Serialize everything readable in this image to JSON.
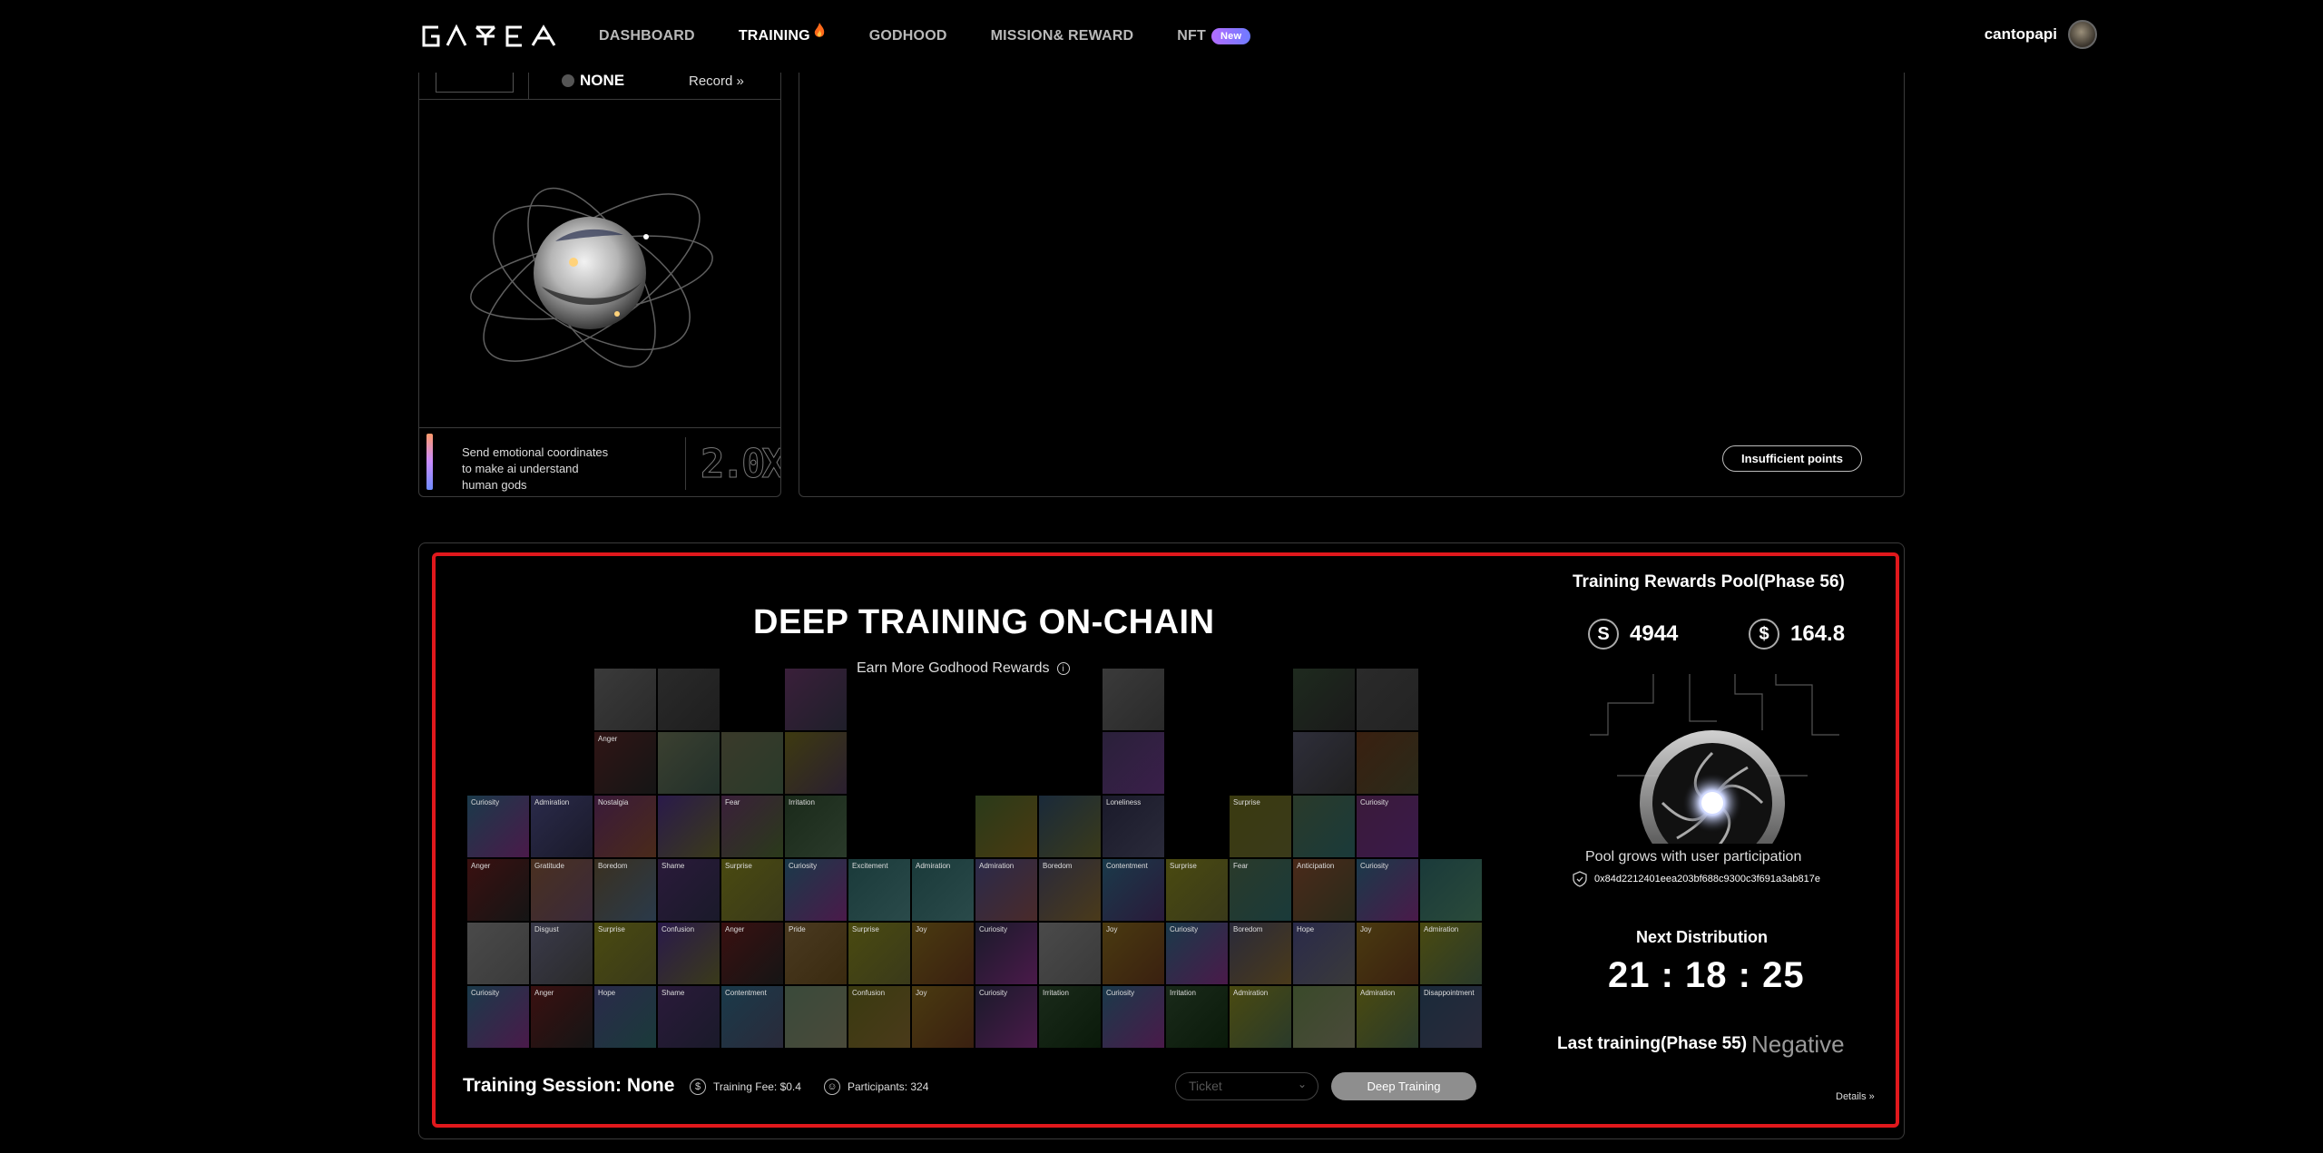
{
  "header": {
    "logo_text": "GAYEA",
    "nav": [
      {
        "label": "DASHBOARD"
      },
      {
        "label": "TRAINING"
      },
      {
        "label": "GODHOOD"
      },
      {
        "label": "MISSION& REWARD"
      },
      {
        "label": "NFT"
      }
    ],
    "nft_badge": "New",
    "username": "cantopapi"
  },
  "left_panel": {
    "status": "NONE",
    "record_label": "Record »",
    "emotion_text": "Send emotional coordinates to make ai understand human gods",
    "multiplier": "2.0X"
  },
  "right_panel": {
    "insufficient_label": "Insufficient points"
  },
  "deep_training": {
    "title": "DEEP TRAINING ON-CHAIN",
    "subtitle": "Earn More Godhood Rewards",
    "session_label": "Training Session: None",
    "fee_label": "Training Fee: $0.4",
    "participants_label": "Participants: 324",
    "ticket_placeholder": "Ticket",
    "deep_button": "Deep Training",
    "emotion_cells": [
      {
        "col": 2,
        "row": 0,
        "label": "",
        "c1": "#3a3a3a",
        "c2": "#2a2a2a"
      },
      {
        "col": 3,
        "row": 0,
        "label": "",
        "c1": "#2a2a2a",
        "c2": "#1e1e1e"
      },
      {
        "col": 5,
        "row": 0,
        "label": "",
        "c1": "#3a1f3a",
        "c2": "#1f1f2a"
      },
      {
        "col": 10,
        "row": 0,
        "label": "",
        "c1": "#3a3a3a",
        "c2": "#2a2a2a"
      },
      {
        "col": 13,
        "row": 0,
        "label": "",
        "c1": "#1e2a1e",
        "c2": "#1a1a1a"
      },
      {
        "col": 14,
        "row": 0,
        "label": "",
        "c1": "#2a2a2a",
        "c2": "#232323"
      },
      {
        "col": 2,
        "row": 1,
        "label": "Anger",
        "c1": "#301515",
        "c2": "#151515"
      },
      {
        "col": 3,
        "row": 1,
        "label": "",
        "c1": "#3b4030",
        "c2": "#22302a"
      },
      {
        "col": 4,
        "row": 1,
        "label": "",
        "c1": "#3a3a2a",
        "c2": "#2a3a2a"
      },
      {
        "col": 5,
        "row": 1,
        "label": "",
        "c1": "#3e3a10",
        "c2": "#2a1f30"
      },
      {
        "col": 10,
        "row": 1,
        "label": "",
        "c1": "#2a203a",
        "c2": "#3a1f4a"
      },
      {
        "col": 13,
        "row": 1,
        "label": "",
        "c1": "#2e2e3a",
        "c2": "#202020"
      },
      {
        "col": 14,
        "row": 1,
        "label": "",
        "c1": "#3a2010",
        "c2": "#2a2a1a"
      },
      {
        "col": 0,
        "row": 2,
        "label": "Curiosity",
        "c1": "#1a3a4a",
        "c2": "#4a1a4a"
      },
      {
        "col": 1,
        "row": 2,
        "label": "Admiration",
        "c1": "#2a2a4a",
        "c2": "#1a1a2a"
      },
      {
        "col": 2,
        "row": 2,
        "label": "Nostalgia",
        "c1": "#3a1a3a",
        "c2": "#4a2a1a"
      },
      {
        "col": 3,
        "row": 2,
        "label": "",
        "c1": "#2a1a4a",
        "c2": "#3a3a1a"
      },
      {
        "col": 4,
        "row": 2,
        "label": "Fear",
        "c1": "#3a1f3a",
        "c2": "#2a3a1a"
      },
      {
        "col": 5,
        "row": 2,
        "label": "Irritation",
        "c1": "#1a2a1a",
        "c2": "#2a3a2a"
      },
      {
        "col": 8,
        "row": 2,
        "label": "",
        "c1": "#2a3a1a",
        "c2": "#4a3a10"
      },
      {
        "col": 9,
        "row": 2,
        "label": "",
        "c1": "#1a2a3a",
        "c2": "#3a3a1a"
      },
      {
        "col": 10,
        "row": 2,
        "label": "Loneliness",
        "c1": "#1a1a2a",
        "c2": "#2a2a3a"
      },
      {
        "col": 12,
        "row": 2,
        "label": "Surprise",
        "c1": "#3a3a10",
        "c2": "#3a3a1a"
      },
      {
        "col": 13,
        "row": 2,
        "label": "",
        "c1": "#2a3a2a",
        "c2": "#1a3a3a"
      },
      {
        "col": 14,
        "row": 2,
        "label": "Curiosity",
        "c1": "#3a1a3a",
        "c2": "#3a1a4a"
      },
      {
        "col": 0,
        "row": 3,
        "label": "Anger",
        "c1": "#3a1010",
        "c2": "#151515"
      },
      {
        "col": 1,
        "row": 3,
        "label": "Gratitude",
        "c1": "#4a3020",
        "c2": "#3a2a3a"
      },
      {
        "col": 2,
        "row": 3,
        "label": "Boredom",
        "c1": "#3a3020",
        "c2": "#2a3a4a"
      },
      {
        "col": 3,
        "row": 3,
        "label": "Shame",
        "c1": "#2a1a3a",
        "c2": "#1a1a2a"
      },
      {
        "col": 4,
        "row": 3,
        "label": "Surprise",
        "c1": "#4a4a10",
        "c2": "#3a3a1a"
      },
      {
        "col": 5,
        "row": 3,
        "label": "Curiosity",
        "c1": "#1a3a4a",
        "c2": "#4a1a4a"
      },
      {
        "col": 6,
        "row": 3,
        "label": "Excitement",
        "c1": "#1a3a3a",
        "c2": "#2a4a4a"
      },
      {
        "col": 7,
        "row": 3,
        "label": "Admiration",
        "c1": "#1a3a3a",
        "c2": "#2a4a4a"
      },
      {
        "col": 8,
        "row": 3,
        "label": "Admiration",
        "c1": "#2a2a4a",
        "c2": "#4a2a2a"
      },
      {
        "col": 9,
        "row": 3,
        "label": "Boredom",
        "c1": "#2a2a3a",
        "c2": "#4a3a1a"
      },
      {
        "col": 10,
        "row": 3,
        "label": "Contentment",
        "c1": "#1a3a4a",
        "c2": "#2a1a3a"
      },
      {
        "col": 11,
        "row": 3,
        "label": "Surprise",
        "c1": "#4a4a10",
        "c2": "#3a3a1a"
      },
      {
        "col": 12,
        "row": 3,
        "label": "Fear",
        "c1": "#2a3a2a",
        "c2": "#1a3a3a"
      },
      {
        "col": 13,
        "row": 3,
        "label": "Anticipation",
        "c1": "#4a2a1a",
        "c2": "#2a2a1a"
      },
      {
        "col": 14,
        "row": 3,
        "label": "Curiosity",
        "c1": "#1a3a4a",
        "c2": "#4a1a4a"
      },
      {
        "col": 15,
        "row": 3,
        "label": "",
        "c1": "#1a3a3a",
        "c2": "#2a4a3a"
      },
      {
        "col": 0,
        "row": 4,
        "label": "",
        "c1": "#4a4a4a",
        "c2": "#3a3a3a"
      },
      {
        "col": 1,
        "row": 4,
        "label": "Disgust",
        "c1": "#3a3a4a",
        "c2": "#2a2a2a"
      },
      {
        "col": 2,
        "row": 4,
        "label": "Surprise",
        "c1": "#4a4a10",
        "c2": "#3a3a1a"
      },
      {
        "col": 3,
        "row": 4,
        "label": "Confusion",
        "c1": "#2a1a4a",
        "c2": "#3a3a1a"
      },
      {
        "col": 4,
        "row": 4,
        "label": "Anger",
        "c1": "#3a1010",
        "c2": "#151515"
      },
      {
        "col": 5,
        "row": 4,
        "label": "Pride",
        "c1": "#4a3a20",
        "c2": "#3a2a10"
      },
      {
        "col": 6,
        "row": 4,
        "label": "Surprise",
        "c1": "#4a4a10",
        "c2": "#3a3a1a"
      },
      {
        "col": 7,
        "row": 4,
        "label": "Joy",
        "c1": "#4a3a10",
        "c2": "#3a2010"
      },
      {
        "col": 8,
        "row": 4,
        "label": "Curiosity",
        "c1": "#1a1a2a",
        "c2": "#4a1a4a"
      },
      {
        "col": 9,
        "row": 4,
        "label": "",
        "c1": "#4a4a4a",
        "c2": "#3a3a3a"
      },
      {
        "col": 10,
        "row": 4,
        "label": "Joy",
        "c1": "#4a3a10",
        "c2": "#3a2010"
      },
      {
        "col": 11,
        "row": 4,
        "label": "Curiosity",
        "c1": "#1a3a4a",
        "c2": "#4a1a4a"
      },
      {
        "col": 12,
        "row": 4,
        "label": "Boredom",
        "c1": "#2a2a3a",
        "c2": "#4a3a1a"
      },
      {
        "col": 13,
        "row": 4,
        "label": "Hope",
        "c1": "#2a2a4a",
        "c2": "#3a3a3a"
      },
      {
        "col": 14,
        "row": 4,
        "label": "Joy",
        "c1": "#4a3a10",
        "c2": "#3a2010"
      },
      {
        "col": 15,
        "row": 4,
        "label": "Admiration",
        "c1": "#4a4a10",
        "c2": "#2a3a2a"
      },
      {
        "col": 0,
        "row": 5,
        "label": "Curiosity",
        "c1": "#1a3a4a",
        "c2": "#4a1a4a"
      },
      {
        "col": 1,
        "row": 5,
        "label": "Anger",
        "c1": "#3a1010",
        "c2": "#151515"
      },
      {
        "col": 2,
        "row": 5,
        "label": "Hope",
        "c1": "#2a2a4a",
        "c2": "#1a3a3a"
      },
      {
        "col": 3,
        "row": 5,
        "label": "Shame",
        "c1": "#2a1a3a",
        "c2": "#1a1a2a"
      },
      {
        "col": 4,
        "row": 5,
        "label": "Contentment",
        "c1": "#1a3a4a",
        "c2": "#2a2a3a"
      },
      {
        "col": 5,
        "row": 5,
        "label": "",
        "c1": "#3a4a3a",
        "c2": "#4a4a3a"
      },
      {
        "col": 6,
        "row": 5,
        "label": "Confusion",
        "c1": "#3a3a10",
        "c2": "#4a3a1a"
      },
      {
        "col": 7,
        "row": 5,
        "label": "Joy",
        "c1": "#4a3a10",
        "c2": "#3a2010"
      },
      {
        "col": 8,
        "row": 5,
        "label": "Curiosity",
        "c1": "#1a1a2a",
        "c2": "#4a1a4a"
      },
      {
        "col": 9,
        "row": 5,
        "label": "Irritation",
        "c1": "#1a2a1a",
        "c2": "#0a1a0a"
      },
      {
        "col": 10,
        "row": 5,
        "label": "Curiosity",
        "c1": "#1a3a4a",
        "c2": "#4a1a4a"
      },
      {
        "col": 11,
        "row": 5,
        "label": "Irritation",
        "c1": "#1a2a1a",
        "c2": "#0a1a0a"
      },
      {
        "col": 12,
        "row": 5,
        "label": "Admiration",
        "c1": "#4a4a10",
        "c2": "#2a3a2a"
      },
      {
        "col": 13,
        "row": 5,
        "label": "",
        "c1": "#3a4a2a",
        "c2": "#4a4a3a"
      },
      {
        "col": 14,
        "row": 5,
        "label": "Admiration",
        "c1": "#4a4a10",
        "c2": "#2a3a2a"
      },
      {
        "col": 15,
        "row": 5,
        "label": "Disappointment",
        "c1": "#1a2a3a",
        "c2": "#2a2a3a"
      }
    ]
  },
  "rewards": {
    "pool_title": "Training Rewards Pool(Phase 56)",
    "token1_value": "4944",
    "token2_value": "164.8",
    "pool_grows": "Pool grows with user participation",
    "address": "0x84d2212401eea203bf688c9300c3f691a3ab817e",
    "next_title": "Next Distribution",
    "countdown": "21 : 18 : 25",
    "last_label": "Last training(Phase 55)",
    "last_value": "Negative",
    "details_label": "Details »"
  }
}
